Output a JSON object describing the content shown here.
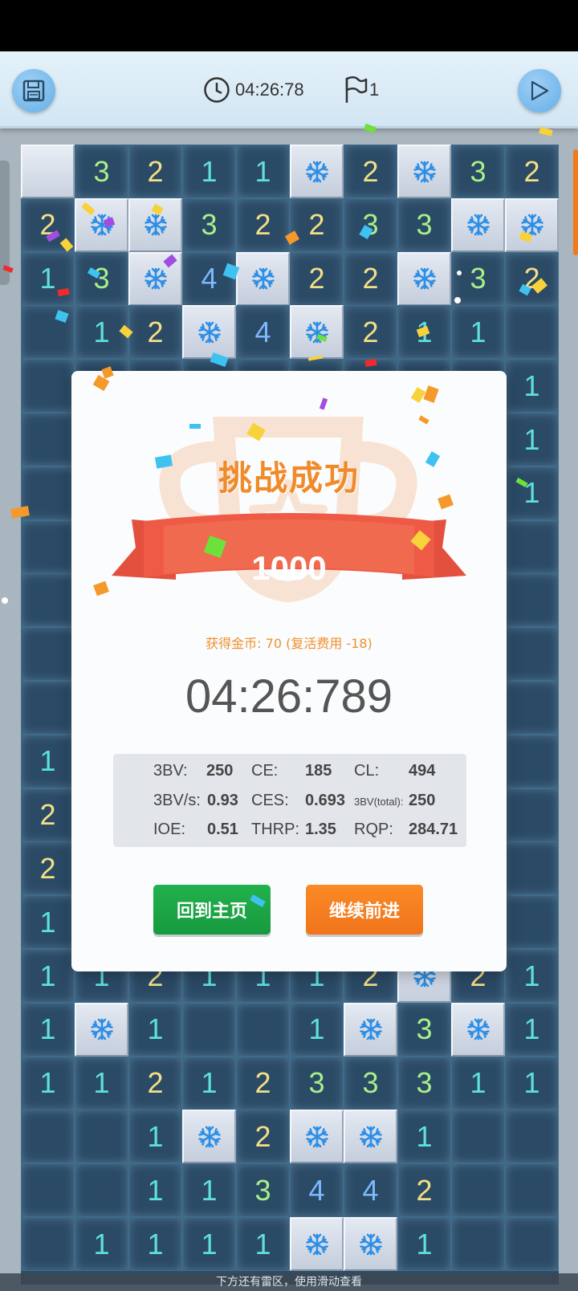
{
  "toolbar": {
    "timer": "04:26:78",
    "flags": "1"
  },
  "board": {
    "cols": 10,
    "rows": [
      [
        "U",
        "3",
        "2",
        "1",
        "1",
        "M",
        "2",
        "M",
        "3",
        "2"
      ],
      [
        "2",
        "M",
        "M",
        "3",
        "2",
        "2",
        "3",
        "3",
        "M",
        "M"
      ],
      [
        "1",
        "3",
        "M",
        "4",
        "M",
        "2",
        "2",
        "M",
        "3",
        "2"
      ],
      [
        "",
        "1",
        "2",
        "M",
        "4",
        "M",
        "2",
        "1",
        "1",
        ""
      ],
      [
        "",
        "",
        "",
        "",
        "",
        "",
        "",
        "",
        "",
        "1"
      ],
      [
        "",
        "",
        "",
        "",
        "",
        "",
        "",
        "",
        "",
        "1"
      ],
      [
        "",
        "",
        "",
        "",
        "",
        "",
        "",
        "",
        "",
        "1"
      ],
      [
        "",
        "",
        "",
        "",
        "",
        "",
        "",
        "",
        "",
        ""
      ],
      [
        "",
        "",
        "",
        "",
        "",
        "",
        "",
        "",
        "",
        ""
      ],
      [
        "",
        "",
        "",
        "",
        "",
        "",
        "",
        "",
        "",
        ""
      ],
      [
        "",
        "",
        "",
        "",
        "",
        "",
        "",
        "",
        "",
        ""
      ],
      [
        "1",
        "",
        "",
        "",
        "",
        "",
        "",
        "",
        "",
        ""
      ],
      [
        "2",
        "",
        "",
        "",
        "",
        "",
        "",
        "",
        "",
        ""
      ],
      [
        "2",
        "",
        "",
        "",
        "",
        "",
        "",
        "",
        "",
        ""
      ],
      [
        "1",
        "",
        "",
        "",
        "",
        "",
        "",
        "",
        "",
        ""
      ],
      [
        "1",
        "1",
        "2",
        "1",
        "1",
        "1",
        "2",
        "M",
        "2",
        "1"
      ],
      [
        "1",
        "M",
        "1",
        "",
        "",
        "1",
        "M",
        "3",
        "M",
        "1"
      ],
      [
        "1",
        "1",
        "2",
        "1",
        "2",
        "3",
        "3",
        "3",
        "1",
        "1"
      ],
      [
        "",
        "",
        "1",
        "M",
        "2",
        "M",
        "M",
        "1",
        "",
        ""
      ],
      [
        "",
        "",
        "1",
        "1",
        "3",
        "4",
        "4",
        "2",
        "",
        ""
      ],
      [
        "",
        "1",
        "1",
        "1",
        "1",
        "M",
        "M",
        "1",
        "",
        ""
      ]
    ],
    "number_colors": {
      "1": "#5ee0dc",
      "2": "#f3df86",
      "3": "#a8f08a",
      "4": "#7db8ff"
    }
  },
  "dialog": {
    "title": "挑战成功",
    "score": "1000",
    "coins": "获得金币: 70 (复活费用 -18)",
    "time": "04:26:789",
    "stats": [
      {
        "label": "3BV:",
        "value": "250"
      },
      {
        "label": "CE:",
        "value": "185"
      },
      {
        "label": "CL:",
        "value": "494"
      },
      {
        "label": "3BV/s:",
        "value": "0.93"
      },
      {
        "label": "CES:",
        "value": "0.693"
      },
      {
        "label": "3BV(total):",
        "value": "250"
      },
      {
        "label": "IOE:",
        "value": "0.51"
      },
      {
        "label": "THRP:",
        "value": "1.35"
      },
      {
        "label": "RQP:",
        "value": "284.71"
      }
    ],
    "home_button": "回到主页",
    "next_button": "继续前进"
  },
  "bottom_hint": "下方还有雷区，使用滑动查看",
  "colors": {
    "accent_orange": "#f08a2a",
    "button_green": "#1fa848",
    "button_orange": "#f7801f",
    "ribbon_red": "#ee5a45"
  }
}
